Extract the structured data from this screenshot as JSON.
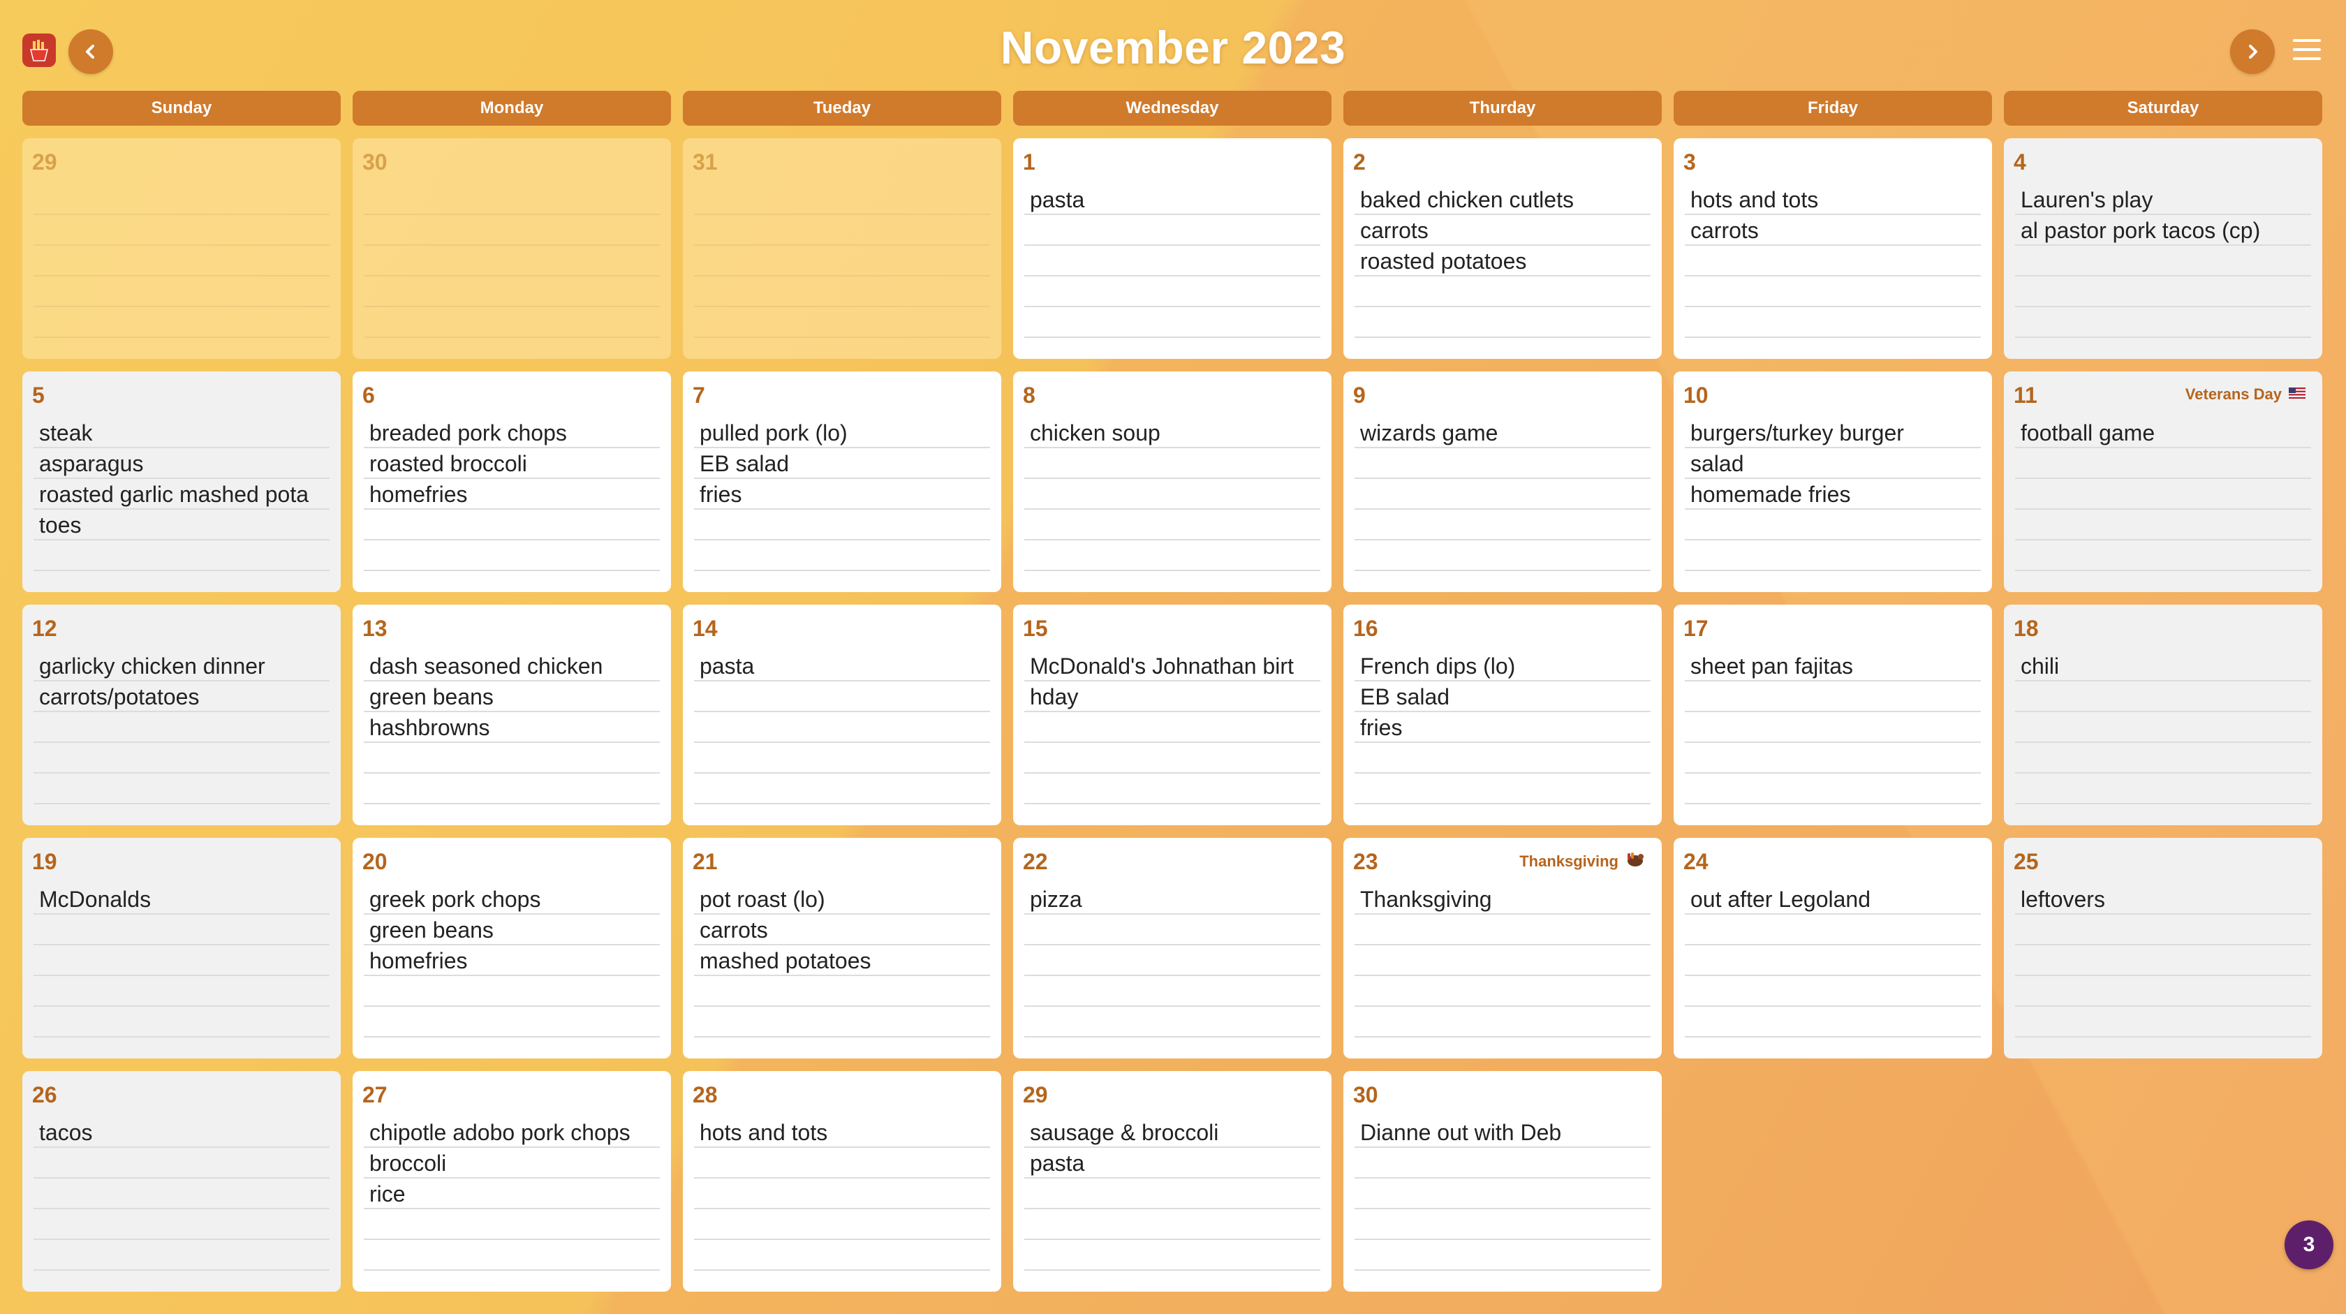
{
  "header": {
    "app_icon": "fries-icon",
    "title": "November 2023",
    "prev_icon": "chevron-left-icon",
    "next_icon": "chevron-right-icon",
    "menu_icon": "hamburger-menu-icon"
  },
  "weekdays": [
    "Sunday",
    "Monday",
    "Tueday",
    "Wednesday",
    "Thurday",
    "Friday",
    "Saturday"
  ],
  "weeks": [
    [
      {
        "day": "29",
        "other": true,
        "entries": []
      },
      {
        "day": "30",
        "other": true,
        "entries": []
      },
      {
        "day": "31",
        "other": true,
        "entries": []
      },
      {
        "day": "1",
        "entries": [
          "pasta"
        ]
      },
      {
        "day": "2",
        "entries": [
          "baked chicken cutlets",
          "carrots",
          "roasted potatoes"
        ]
      },
      {
        "day": "3",
        "entries": [
          "hots and tots",
          "carrots"
        ]
      },
      {
        "day": "4",
        "entries": [
          "Lauren's play",
          "al pastor pork tacos (cp)"
        ]
      }
    ],
    [
      {
        "day": "5",
        "entries": [
          "steak",
          "asparagus",
          "roasted garlic mashed pota",
          "toes"
        ]
      },
      {
        "day": "6",
        "entries": [
          "breaded pork chops",
          "roasted broccoli",
          "homefries"
        ]
      },
      {
        "day": "7",
        "entries": [
          "pulled pork (lo)",
          "EB salad",
          "fries"
        ]
      },
      {
        "day": "8",
        "entries": [
          "chicken soup"
        ]
      },
      {
        "day": "9",
        "entries": [
          "wizards game"
        ]
      },
      {
        "day": "10",
        "entries": [
          "burgers/turkey burger",
          "salad",
          "homemade fries"
        ]
      },
      {
        "day": "11",
        "holiday": "Veterans Day",
        "holiday_icon": "us-flag-icon",
        "entries": [
          "football game"
        ]
      }
    ],
    [
      {
        "day": "12",
        "entries": [
          "garlicky chicken dinner",
          "carrots/potatoes"
        ]
      },
      {
        "day": "13",
        "entries": [
          "dash seasoned chicken",
          "green beans",
          "hashbrowns"
        ]
      },
      {
        "day": "14",
        "entries": [
          "pasta"
        ]
      },
      {
        "day": "15",
        "entries": [
          "McDonald's Johnathan birt",
          "hday"
        ]
      },
      {
        "day": "16",
        "entries": [
          "French dips (lo)",
          "EB salad",
          "fries"
        ]
      },
      {
        "day": "17",
        "entries": [
          "sheet pan fajitas"
        ]
      },
      {
        "day": "18",
        "entries": [
          "chili"
        ]
      }
    ],
    [
      {
        "day": "19",
        "entries": [
          "McDonalds"
        ]
      },
      {
        "day": "20",
        "entries": [
          "greek pork chops",
          "green beans",
          "homefries"
        ]
      },
      {
        "day": "21",
        "entries": [
          "pot roast (lo)",
          "carrots",
          "mashed potatoes"
        ]
      },
      {
        "day": "22",
        "entries": [
          "pizza"
        ]
      },
      {
        "day": "23",
        "holiday": "Thanksgiving",
        "holiday_icon": "turkey-icon",
        "entries": [
          "Thanksgiving"
        ]
      },
      {
        "day": "24",
        "entries": [
          "out after Legoland"
        ]
      },
      {
        "day": "25",
        "entries": [
          "leftovers"
        ]
      }
    ],
    [
      {
        "day": "26",
        "entries": [
          "tacos"
        ]
      },
      {
        "day": "27",
        "entries": [
          "chipotle adobo pork chops",
          "broccoli",
          "rice"
        ]
      },
      {
        "day": "28",
        "entries": [
          "hots and tots"
        ]
      },
      {
        "day": "29",
        "entries": [
          "sausage & broccoli",
          "pasta"
        ]
      },
      {
        "day": "30",
        "entries": [
          "Dianne out with Deb"
        ]
      },
      {
        "empty": true
      },
      {
        "empty": true
      }
    ]
  ],
  "badge": {
    "count": "3"
  },
  "colors": {
    "accent": "#d07a2c",
    "day_number": "#b5651d",
    "badge": "#5e1f6a"
  }
}
